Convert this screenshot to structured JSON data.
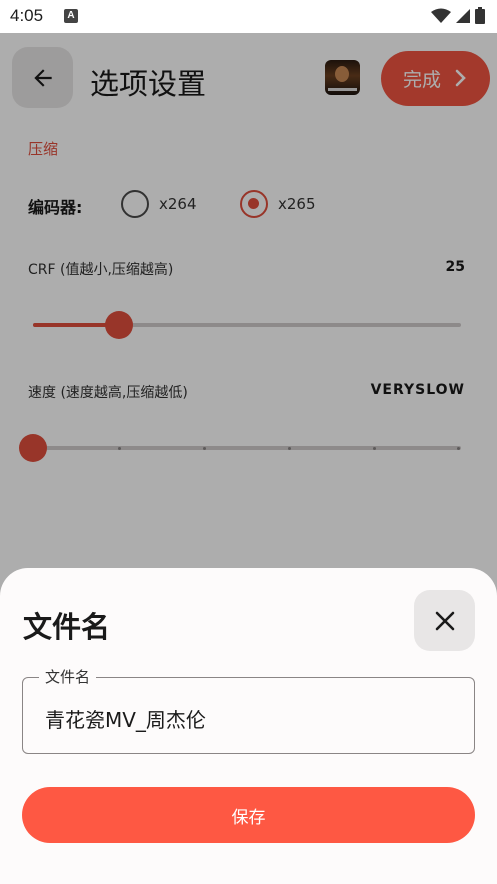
{
  "status_bar": {
    "time": "4:05",
    "notification_badge": "A"
  },
  "appbar": {
    "title": "选项设置",
    "done_label": "完成"
  },
  "compression": {
    "section_label": "压缩",
    "codec_label": "编码器:",
    "codec_options": [
      {
        "label": "x264",
        "selected": false
      },
      {
        "label": "x265",
        "selected": true
      }
    ],
    "crf_label": "CRF (值越小,压缩越高)",
    "crf_value": "25",
    "crf_fraction": 0.2,
    "speed_label": "速度 (速度越高,压缩越低)",
    "speed_value": "VERYSLOW",
    "speed_fraction": 0.0
  },
  "sheet": {
    "title": "文件名",
    "field_legend": "文件名",
    "field_value": "青花瓷MV_周杰伦",
    "save_label": "保存"
  },
  "colors": {
    "accent": "#e14e3d",
    "button": "#fe5843"
  },
  "icons": [
    "back-arrow-icon",
    "chevron-right-icon",
    "close-icon",
    "wifi-icon",
    "signal-icon",
    "battery-icon"
  ]
}
